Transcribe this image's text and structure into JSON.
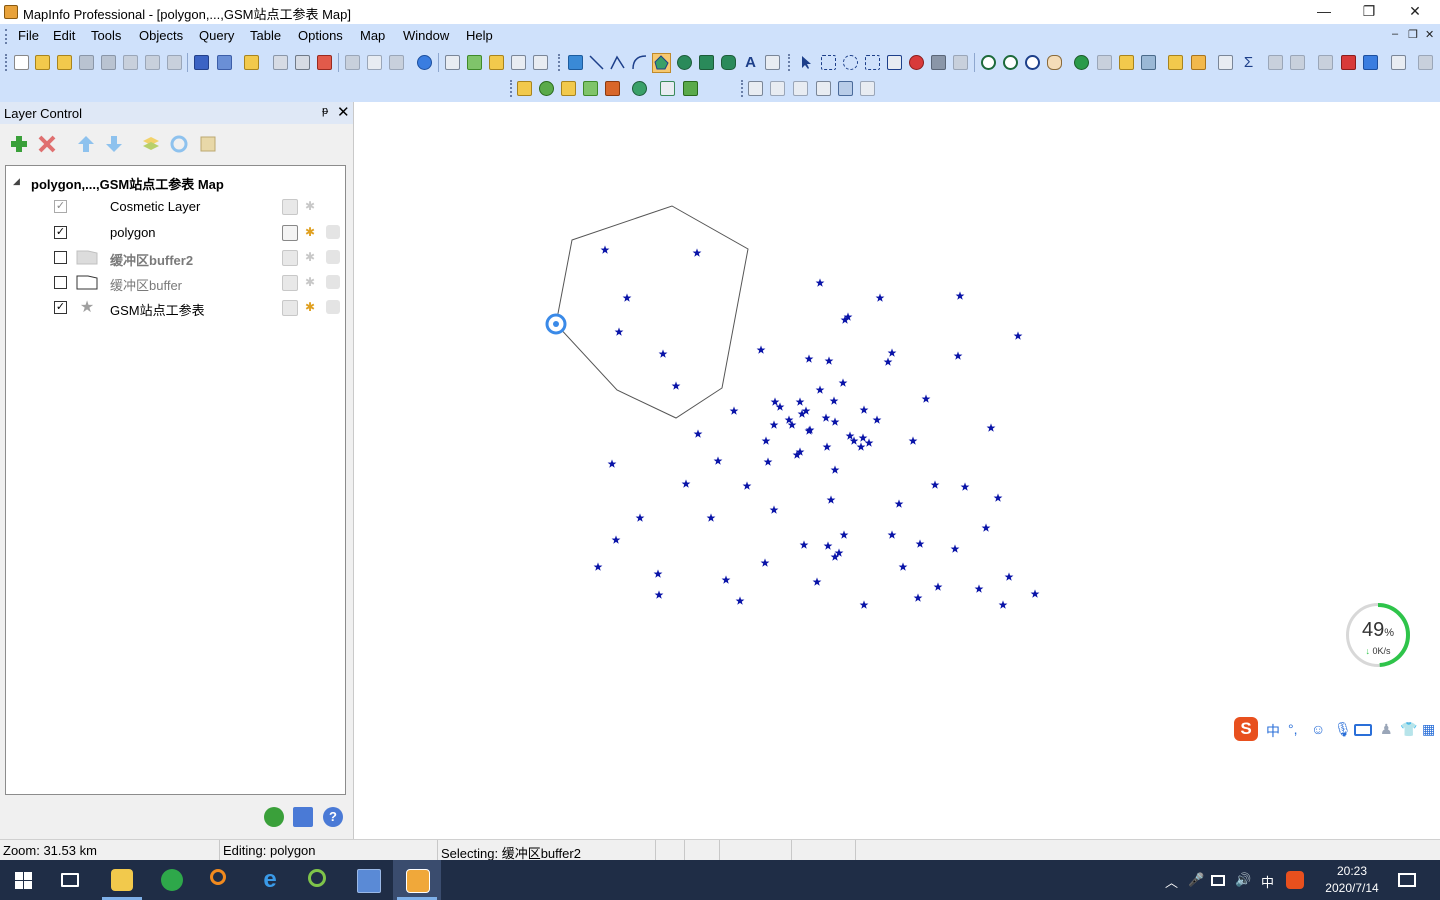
{
  "window": {
    "title": "MapInfo Professional - [polygon,...,GSM站点工参表 Map]",
    "minimize": "—",
    "maximize": "❐",
    "close": "✕"
  },
  "menu": {
    "items": [
      "File",
      "Edit",
      "Tools",
      "Objects",
      "Query",
      "Table",
      "Options",
      "Map",
      "Window",
      "Help"
    ],
    "mdi_min": "–",
    "mdi_restore": "❐",
    "mdi_close": "✕"
  },
  "layer_control": {
    "title": "Layer Control",
    "pin": "ᵽ",
    "close": "✕",
    "root": "polygon,...,GSM站点工参表 Map",
    "layers": [
      {
        "name": "Cosmetic Layer",
        "checked": true,
        "dim": true,
        "style": "normal"
      },
      {
        "name": "polygon",
        "checked": true,
        "dim": false,
        "style": "normal"
      },
      {
        "name": "缓冲区buffer2",
        "checked": false,
        "dim": false,
        "style": "grey-bold"
      },
      {
        "name": "缓冲区buffer",
        "checked": false,
        "dim": false,
        "style": "grey"
      },
      {
        "name": "GSM站点工参表",
        "checked": true,
        "dim": false,
        "style": "normal"
      }
    ]
  },
  "status": {
    "zoom": "Zoom: 31.53 km",
    "editing": "Editing: polygon",
    "selecting": "Selecting: 缓冲区buffer2"
  },
  "net_widget": {
    "percent": "49",
    "percent_unit": "%",
    "speed": "0K/s"
  },
  "ime": {
    "logo": "S",
    "lang": "中",
    "punct": "°,"
  },
  "taskbar": {
    "tray_lang": "中",
    "time": "20:23",
    "date": "2020/7/14"
  },
  "colors": {
    "accent": "#cfe1fb",
    "point_color": "#0a14a8",
    "taskbar": "#1f2d46"
  }
}
